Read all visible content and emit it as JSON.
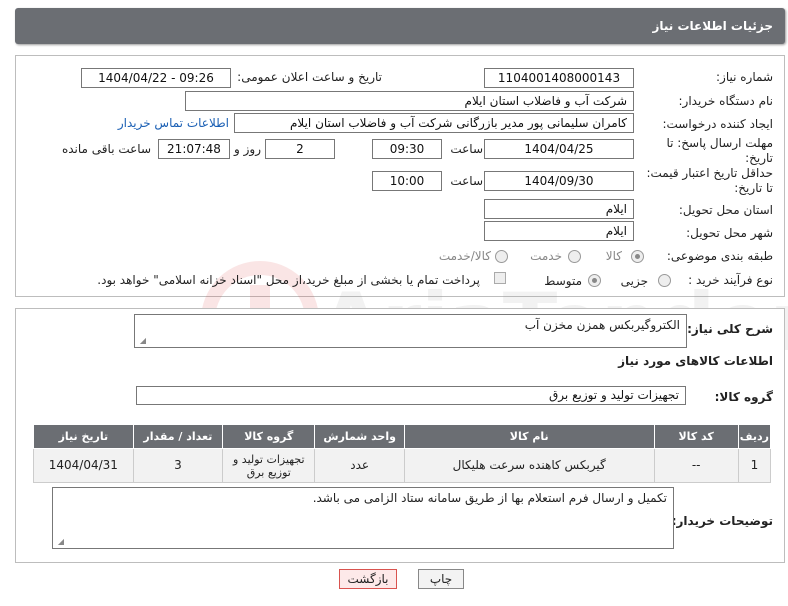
{
  "header": {
    "title": "جزئیات اطلاعات نیاز"
  },
  "form": {
    "need_number_label": "شماره نیاز:",
    "need_number": "1104001408000143",
    "announce_label": "تاریخ و ساعت اعلان عمومی:",
    "announce_value": "1404/04/22 - 09:26",
    "buyer_org_label": "نام دستگاه خریدار:",
    "buyer_org": "شرکت آب و فاضلاب استان ایلام",
    "creator_label": "ایجاد کننده درخواست:",
    "creator": "کامران سلیمانی پور مدیر بازرگانی شرکت آب و فاضلاب استان ایلام",
    "contact_link": "اطلاعات تماس خریدار",
    "deadline_label_1": "مهلت ارسال پاسخ: تا",
    "deadline_label_2": "تاریخ:",
    "deadline_date": "1404/04/25",
    "time_label": "ساعت",
    "deadline_time": "09:30",
    "days_value": "2",
    "days_label": "روز و",
    "remaining_time": "21:07:48",
    "remaining_label": "ساعت باقی مانده",
    "min_price_label_1": "حداقل تاریخ اعتبار قیمت:",
    "min_price_label_2": "تا تاریخ:",
    "price_date": "1404/09/30",
    "price_time": "10:00",
    "province_label": "استان محل تحویل:",
    "province": "ایلام",
    "city_label": "شهر محل تحویل:",
    "city": "ایلام",
    "category_label": "طبقه بندی موضوعی:",
    "category_options": [
      "کالا",
      "خدمت",
      "کالا/خدمت"
    ],
    "process_label": "نوع فرآیند خرید :",
    "process_options": [
      "جزیی",
      "متوسط"
    ],
    "payment_note": "پرداخت تمام یا بخشی از مبلغ خرید،از محل \"اسناد خزانه اسلامی\" خواهد بود."
  },
  "description": {
    "label": "شرح کلی نیاز:",
    "value": "الکتروگیربکس همزن مخزن آب"
  },
  "goods": {
    "section_title": "اطلاعات کالاهای مورد نیاز",
    "group_label": "گروه کالا:",
    "group_value": "تجهیزات تولید و توزیع برق",
    "columns": [
      "ردیف",
      "کد کالا",
      "نام کالا",
      "واحد شمارش",
      "گروه کالا",
      "تعداد / مقدار",
      "تاریخ نیاز"
    ],
    "rows": [
      [
        "1",
        "--",
        "گیربکس کاهنده سرعت هلیکال",
        "عدد",
        "تجهیزات تولید و توزیع برق",
        "3",
        "1404/04/31"
      ]
    ]
  },
  "buyer_notes": {
    "label": "توضیحات خریدار:",
    "value": "تکمیل و ارسال فرم استعلام بها از طریق سامانه ستاد الزامی می باشد."
  },
  "buttons": {
    "print": "چاپ",
    "back": "بازگشت"
  },
  "watermark_text": "AriaTender.neT",
  "colors": {
    "header_bg": "#6b6e73",
    "link": "#1a5fb4",
    "back_button_border": "#d9534f"
  }
}
